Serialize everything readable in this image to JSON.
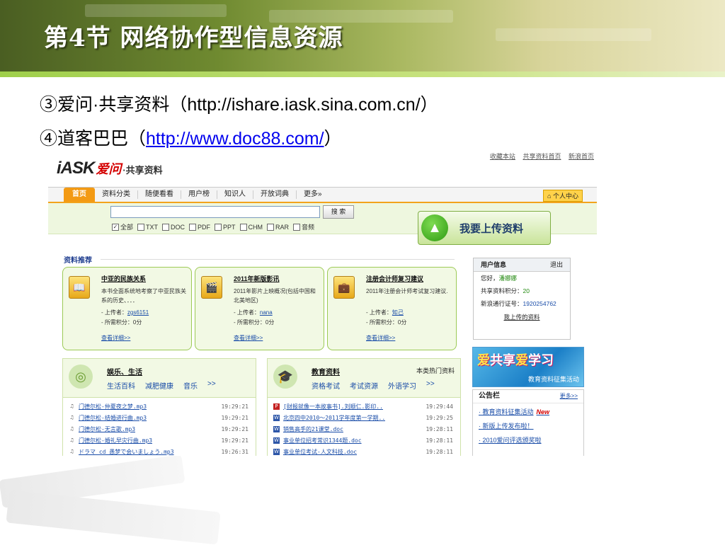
{
  "slide": {
    "title": "第4节 网络协作型信息资源",
    "line1": "③爱问·共享资料（http://ishare.iask.sina.com.cn/）",
    "line2_prefix": "④道客巴巴（",
    "line2_link": "http://www.doc88.com/",
    "line2_suffix": "）"
  },
  "colors": {
    "accent_orange": "#f39a14",
    "accent_green": "#9cca55",
    "link_blue": "#1a4da8"
  },
  "site": {
    "toplinks": [
      "收藏本站",
      "共享资料首页",
      "新浪首页"
    ],
    "logo": {
      "iask": "iASK",
      "aiwen": "爱问",
      "share": "·共享资料"
    },
    "nav": [
      "首页",
      "资料分类",
      "随便看看",
      "用户榜",
      "知识人",
      "开放词典",
      "更多»"
    ],
    "user_center": "个人中心",
    "search": {
      "value": "",
      "button": "搜 索"
    },
    "filters": [
      {
        "label": "全部",
        "checked": true
      },
      {
        "label": "TXT",
        "checked": false
      },
      {
        "label": "DOC",
        "checked": false
      },
      {
        "label": "PDF",
        "checked": false
      },
      {
        "label": "PPT",
        "checked": false
      },
      {
        "label": "CHM",
        "checked": false
      },
      {
        "label": "RAR",
        "checked": false
      },
      {
        "label": "音频",
        "checked": false
      }
    ],
    "upload_label": "我要上传资料",
    "recommend_title": "资料推荐",
    "cards": [
      {
        "title": "中亚的民族关系",
        "desc": "本书全面系统地考察了中亚民族关系的历史、．．．",
        "uploader_label": "- 上传者：",
        "uploader": "zgs6151",
        "points": "- 所需积分：0分",
        "more": "查看详细>>"
      },
      {
        "title": "2011年新版影讯",
        "desc": "2011年影片上映概况(包括中国和北美地区)",
        "uploader_label": "- 上传者：",
        "uploader": "nana",
        "points": "- 所需积分：0分",
        "more": "查看详细>>"
      },
      {
        "title": "注册会计师复习建议",
        "desc": "2011年注册会计师考试复习建议.",
        "uploader_label": "- 上传者：",
        "uploader": "知己",
        "points": "- 所需积分：0分",
        "more": "查看详细>>"
      }
    ],
    "userinfo": {
      "header": "用户信息",
      "logout": "退出",
      "hello_label": "您好，",
      "hello_name": "潘娜娜",
      "points_label": "共享资料积分：",
      "points_value": "20",
      "id_label": "新浪通行证号：",
      "id_value": "1920254762",
      "my_uploads": "我上传的资料"
    },
    "banner": {
      "part1": "爱",
      "part2": "共享",
      "part3": "爱",
      "part4": "学习",
      "sub": "教育资料征集活动"
    },
    "notice": {
      "title": "公告栏",
      "more": "更多>>",
      "items": [
        "· 教育资料征集活动",
        "· 新版上传发布啦！",
        "· 2010爱问评选颁奖啦"
      ],
      "new_badge": "New"
    },
    "panel_ent": {
      "title": "娱乐、生活",
      "links": [
        "生活百科",
        "减肥健康",
        "音乐",
        ">>"
      ],
      "rows": [
        {
          "name": "门德尔松-仲夏夜之梦.mp3",
          "time": "19:29:21"
        },
        {
          "name": "门德尔松-结婚进行曲.mp3",
          "time": "19:29:21"
        },
        {
          "name": "门德尔松-无言歌.mp3",
          "time": "19:29:21"
        },
        {
          "name": "门德尔松-婚礼早灾行曲.mp3",
          "time": "19:29:21"
        },
        {
          "name": "ドラマ cd 愚梦で会いましょう.mp3",
          "time": "19:26:31"
        }
      ]
    },
    "panel_edu": {
      "title": "教育资料",
      "hot": "本类热门资料",
      "links": [
        "资格考试",
        "考试资源",
        "外语学习",
        ">>"
      ],
      "rows": [
        {
          "name": "[财报就像一本故事书].刘顺仁.影印..",
          "time": "19:29:44",
          "type": "pdf"
        },
        {
          "name": "北京四中2010～2011学年度第一学期..",
          "time": "19:29:25",
          "type": "word"
        },
        {
          "name": "销售高手的21课堂.doc",
          "time": "19:28:11",
          "type": "word"
        },
        {
          "name": "事业单位招考常识1344题.doc",
          "time": "19:28:11",
          "type": "word"
        },
        {
          "name": "事业单位考试-人文科技.doc",
          "time": "19:28:11",
          "type": "word"
        }
      ]
    }
  }
}
